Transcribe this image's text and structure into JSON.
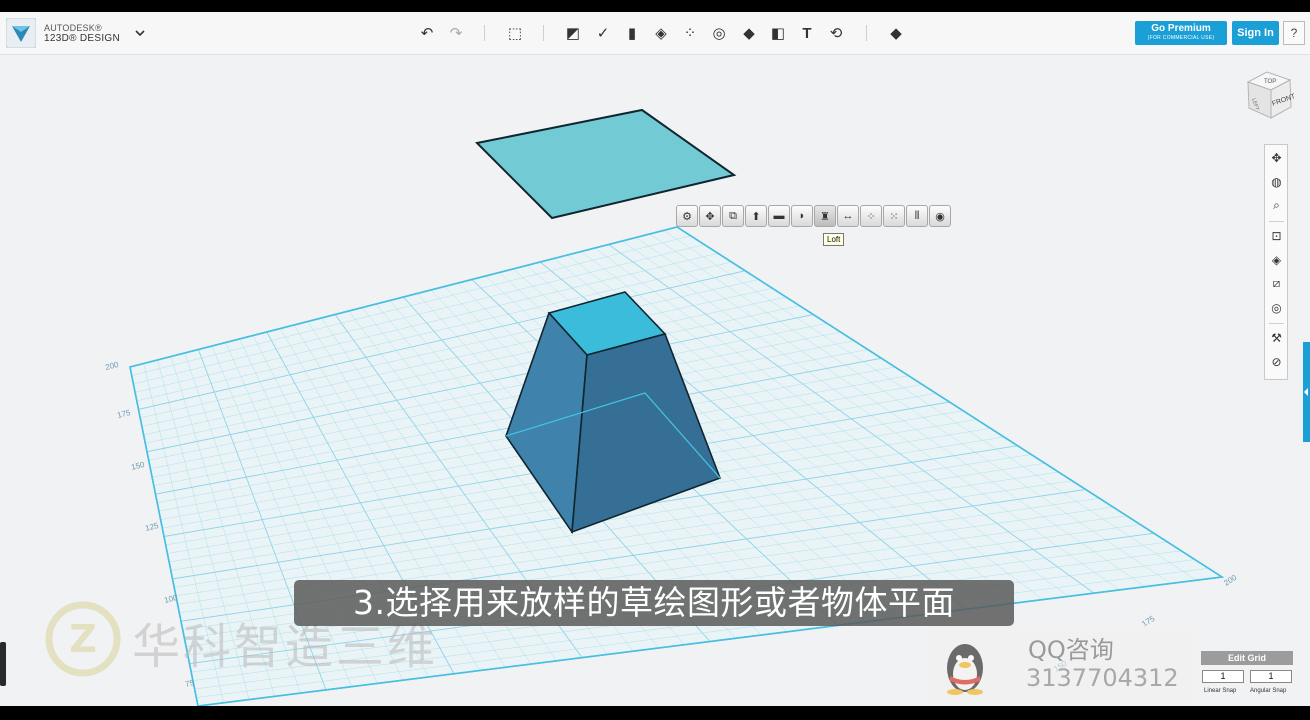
{
  "app": {
    "brand_line1": "AUTODESK®",
    "brand_line2": "123D® DESIGN",
    "brand_color": "#1a9fd7"
  },
  "toolbar": {
    "icons": [
      "undo-icon",
      "redo-icon",
      "primitives-icon",
      "sketch-icon",
      "construct-icon",
      "modify-icon",
      "pattern-icon",
      "grouping-icon",
      "combine-icon",
      "measure-icon",
      "text-icon",
      "snap-icon",
      "material-icon"
    ],
    "premium_label": "Go Premium",
    "premium_sub": "(FOR COMMERCIAL USE)",
    "signin_label": "Sign In",
    "help_label": "?"
  },
  "viewcube": {
    "top": "TOP",
    "front": "FRONT",
    "left": "LEFT"
  },
  "context_toolbar": {
    "icons": [
      "settings-icon",
      "move-icon",
      "smart-scale-icon",
      "extrude-icon",
      "sweep-icon",
      "revolve-icon",
      "loft-icon",
      "dimension-icon",
      "pattern-icon",
      "group-icon",
      "mirror-icon",
      "visibility-icon"
    ],
    "tooltip": "Loft"
  },
  "grid_labels": {
    "left": [
      "200",
      "175",
      "150",
      "125",
      "100",
      "75"
    ],
    "right": [
      "200",
      "175",
      "150"
    ]
  },
  "edit_grid": {
    "title": "Edit Grid",
    "linear_value": "1",
    "angular_value": "1",
    "linear_label": "Linear Snap",
    "angular_label": "Angular Snap"
  },
  "overlay": {
    "subtitle": "3.选择用来放样的草绘图形或者物体平面",
    "watermark": "华科智造三维",
    "qq_title": "QQ咨询",
    "qq_number": "3137704312"
  },
  "colors": {
    "shape_top": "#3bbcdb",
    "shape_side": "#3a7fa8",
    "sketch_fill": "#72cbd4",
    "grid_line": "#a7dcea"
  }
}
